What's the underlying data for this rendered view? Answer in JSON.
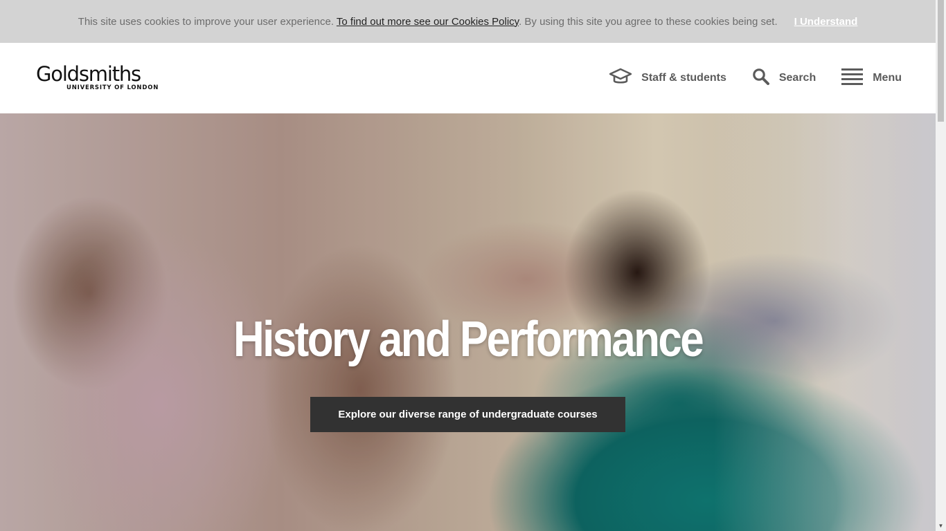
{
  "cookie_banner": {
    "text_before": "This site uses cookies to improve your user experience. ",
    "link_label": "To find out more see our Cookies Policy",
    "text_after": ". By using this site you agree to these cookies being set.",
    "accept_label": "I Understand"
  },
  "header": {
    "logo": {
      "name": "Goldsmiths",
      "subtitle": "UNIVERSITY OF LONDON"
    },
    "nav": [
      {
        "label": "Staff & students",
        "icon": "graduation-cap-icon"
      },
      {
        "label": "Search",
        "icon": "search-icon"
      },
      {
        "label": "Menu",
        "icon": "hamburger-menu-icon"
      }
    ]
  },
  "hero": {
    "title": "History and Performance",
    "cta_label": "Explore our diverse range of undergraduate courses"
  },
  "colors": {
    "cookie_bg": "#d3d3d3",
    "nav_text": "#5b5b5b",
    "cta_bg": "#323232",
    "hero_teal": "#107c77"
  }
}
